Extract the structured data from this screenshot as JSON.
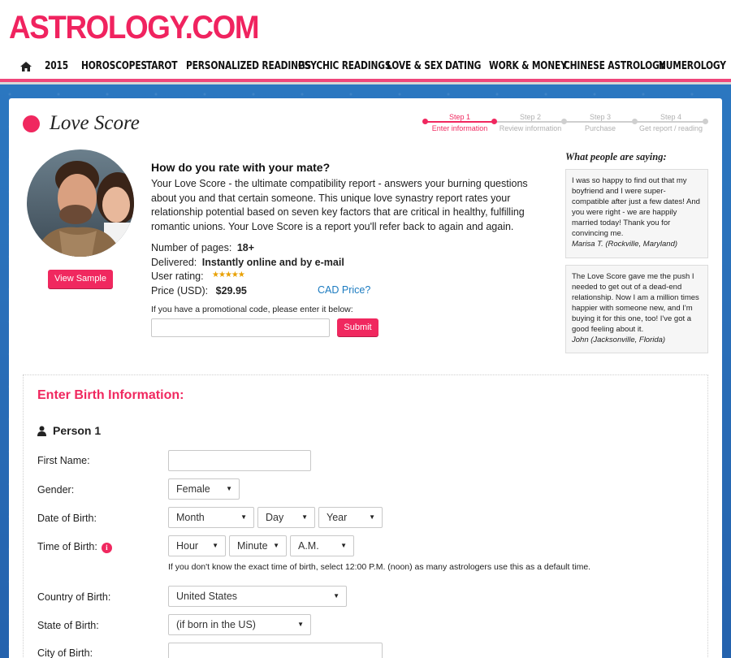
{
  "site": {
    "logo": "ASTROLOGY.COM"
  },
  "nav": {
    "items": [
      {
        "label": "2015"
      },
      {
        "label": "HOROSCOPES"
      },
      {
        "label": "TAROT"
      },
      {
        "label": "PERSONALIZED READINGS"
      },
      {
        "label": "PSYCHIC READINGS"
      },
      {
        "label": "LOVE & SEX"
      },
      {
        "label": "DATING"
      },
      {
        "label": "WORK & MONEY"
      },
      {
        "label": "CHINESE ASTROLOGY"
      },
      {
        "label": "NUMEROLOGY"
      }
    ],
    "home_icon": "home-icon"
  },
  "product": {
    "title": "Love Score",
    "view_sample": "View Sample",
    "question": "How do you rate with your mate?",
    "description": "Your Love Score - the ultimate compatibility report - answers your burning questions about you and that certain someone. This unique love synastry report rates your relationship potential based on seven key factors that are critical in healthy, fulfilling romantic unions. Your Love Score is a report you'll refer back to again and again.",
    "pages_label": "Number of pages:",
    "pages_value": "18+",
    "delivered_label": "Delivered:",
    "delivered_value": "Instantly online and by e-mail",
    "rating_label": "User rating:",
    "rating_stars": 5,
    "price_label": "Price (USD):",
    "price_value": "$29.95",
    "cad_link": "CAD Price?",
    "promo_label": "If you have a promotional code, please enter it below:",
    "promo_value": "",
    "submit": "Submit"
  },
  "steps": [
    {
      "num": "Step 1",
      "label": "Enter information",
      "active": true
    },
    {
      "num": "Step 2",
      "label": "Review information",
      "active": false
    },
    {
      "num": "Step 3",
      "label": "Purchase",
      "active": false
    },
    {
      "num": "Step 4",
      "label": "Get report / reading",
      "active": false
    }
  ],
  "testimonials": {
    "heading": "What people are saying:",
    "items": [
      {
        "text": "I was so happy to find out that my boyfriend and I were super-compatible after just a few dates! And you were right - we are happily married today! Thank you for convincing me.",
        "author": "Marisa T. (Rockville, Maryland)"
      },
      {
        "text": "The Love Score gave me the push I needed to get out of a dead-end relationship. Now I am a million times happier with someone new, and I'm buying it for this one, too! I've got a good feeling about it.",
        "author": "John (Jacksonville, Florida)"
      }
    ]
  },
  "form": {
    "title": "Enter Birth Information:",
    "person": "Person 1",
    "first_name_label": "First Name:",
    "first_name_value": "",
    "gender_label": "Gender:",
    "gender_value": "Female",
    "dob_label": "Date of Birth:",
    "month": "Month",
    "day": "Day",
    "year": "Year",
    "tob_label": "Time of Birth:",
    "hour": "Hour",
    "minute": "Minute",
    "ampm": "A.M.",
    "tob_hint": "If you don't know the exact time of birth, select 12:00 P.M. (noon) as many astrologers use this as a default time.",
    "country_label": "Country of Birth:",
    "country_value": "United States",
    "state_label": "State of Birth:",
    "state_value": "(if born in the US)",
    "city_label": "City of Birth:",
    "city_value": ""
  },
  "colors": {
    "brand": "#f0285f",
    "link": "#1b7bc0",
    "background": "#2b77c0"
  }
}
